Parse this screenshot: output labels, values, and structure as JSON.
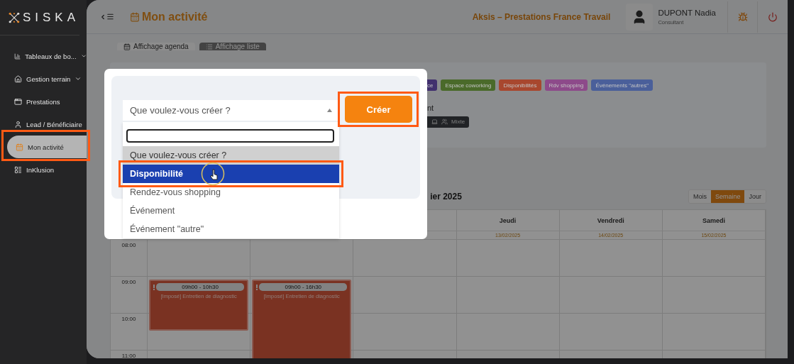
{
  "sidebar": {
    "logo": "SISKA",
    "items": [
      {
        "label": "Tableaux de bo...",
        "expandable": true,
        "selected": false,
        "highlighted": false
      },
      {
        "label": "Gestion terrain",
        "expandable": true,
        "selected": false,
        "highlighted": false
      },
      {
        "label": "Prestations",
        "expandable": false,
        "selected": false,
        "highlighted": false
      },
      {
        "label": "Lead / Bénéficiaire",
        "expandable": false,
        "selected": false,
        "highlighted": false
      },
      {
        "label": "Mon activité",
        "expandable": false,
        "selected": true,
        "highlighted": true
      },
      {
        "label": "InKlusion",
        "expandable": false,
        "selected": false,
        "highlighted": false
      }
    ]
  },
  "header": {
    "title": "Mon activité",
    "organization": "Aksis – Prestations France Travail",
    "user": {
      "name": "DUPONT Nadia",
      "role": "Consultant"
    }
  },
  "view_tabs": [
    {
      "label": "Affichage agenda",
      "selected": true
    },
    {
      "label": "Affichage liste",
      "selected": false
    }
  ],
  "legend": {
    "tags": [
      {
        "label": "ce",
        "color": "#41306e"
      },
      {
        "label": "Espace coworking",
        "color": "#4a6a2a"
      },
      {
        "label": "Disponibilités",
        "color": "#a8472e"
      },
      {
        "label": "Rdv shopping",
        "color": "#8d4a8a"
      },
      {
        "label": "Événements \"autres\"",
        "color": "#4a5f9a"
      }
    ],
    "filter_label": "nt",
    "mode_chip": "Mixte"
  },
  "calendar": {
    "title": "ier 2025",
    "views": [
      {
        "label": "Mois",
        "selected": false
      },
      {
        "label": "Semaine",
        "selected": true
      },
      {
        "label": "Jour",
        "selected": false
      }
    ],
    "columns": [
      {
        "kind": "covered"
      },
      {
        "kind": "covered"
      },
      {
        "kind": "covered"
      },
      {
        "kind": "day",
        "name": "Jeudi",
        "date": "13/02/2025"
      },
      {
        "kind": "day",
        "name": "Vendredi",
        "date": "14/02/2025"
      },
      {
        "kind": "day",
        "name": "Samedi",
        "date": "15/02/2025"
      }
    ],
    "rows": [
      {
        "time": "08:00",
        "events": []
      },
      {
        "time": "09:00",
        "events": [
          {
            "time": "09h00 - 10h30",
            "title": "[Imposé] Entretien de diagnostic",
            "kind": "short"
          },
          {
            "time": "09h00 - 16h30",
            "title": "[Imposé] Entretien de diagnostic",
            "kind": "long"
          }
        ]
      },
      {
        "time": "10:00",
        "events": []
      },
      {
        "time": "11:00",
        "events": []
      }
    ]
  },
  "dialog": {
    "select": {
      "placeholder": "Que voulez-vous créer ?",
      "expanded": true
    },
    "options": [
      {
        "label": "Que voulez-vous créer ?",
        "kind": "placeholder",
        "selected": false,
        "highlighted": false,
        "hovered": false
      },
      {
        "label": "Disponibilité",
        "kind": "option",
        "selected": true,
        "highlighted": true,
        "hovered": true
      },
      {
        "label": "Rendez-vous shopping",
        "kind": "option",
        "selected": false,
        "highlighted": false,
        "hovered": false
      },
      {
        "label": "Événement",
        "kind": "option",
        "selected": false,
        "highlighted": false,
        "hovered": false
      },
      {
        "label": "Événement \"autre\"",
        "kind": "option",
        "selected": false,
        "highlighted": false,
        "hovered": false
      }
    ],
    "button": {
      "label": "Créer",
      "highlighted": true
    }
  }
}
